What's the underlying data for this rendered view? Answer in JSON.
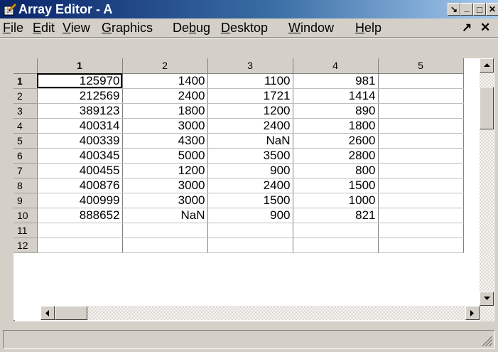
{
  "window": {
    "title": "Array Editor - A"
  },
  "title_buttons": {
    "dock": "↘",
    "minimize": "_",
    "maximize": "□",
    "close": "✕"
  },
  "menu": {
    "items": [
      {
        "accel": "F",
        "rest": "ile"
      },
      {
        "accel": "E",
        "rest": "dit"
      },
      {
        "accel": "V",
        "rest": "iew"
      },
      {
        "accel": "G",
        "rest": "raphics"
      },
      {
        "pre": "De",
        "accel": "b",
        "rest": "ug"
      },
      {
        "accel": "D",
        "rest": "esktop"
      },
      {
        "accel": "W",
        "rest": "indow"
      },
      {
        "accel": "H",
        "rest": "elp"
      }
    ],
    "undock_glyph": "↗",
    "close_glyph": "✕"
  },
  "grid": {
    "columns": [
      "1",
      "2",
      "3",
      "4",
      "5"
    ],
    "rows": [
      {
        "label": "1",
        "cells": [
          "125970",
          "1400",
          "1100",
          "981",
          ""
        ]
      },
      {
        "label": "2",
        "cells": [
          "212569",
          "2400",
          "1721",
          "1414",
          ""
        ]
      },
      {
        "label": "3",
        "cells": [
          "389123",
          "1800",
          "1200",
          "890",
          ""
        ]
      },
      {
        "label": "4",
        "cells": [
          "400314",
          "3000",
          "2400",
          "1800",
          ""
        ]
      },
      {
        "label": "5",
        "cells": [
          "400339",
          "4300",
          "NaN",
          "2600",
          ""
        ]
      },
      {
        "label": "6",
        "cells": [
          "400345",
          "5000",
          "3500",
          "2800",
          ""
        ]
      },
      {
        "label": "7",
        "cells": [
          "400455",
          "1200",
          "900",
          "800",
          ""
        ]
      },
      {
        "label": "8",
        "cells": [
          "400876",
          "3000",
          "2400",
          "1500",
          ""
        ]
      },
      {
        "label": "9",
        "cells": [
          "400999",
          "3000",
          "1500",
          "1000",
          ""
        ]
      },
      {
        "label": "10",
        "cells": [
          "888652",
          "NaN",
          "900",
          "821",
          ""
        ]
      },
      {
        "label": "11",
        "cells": [
          "",
          "",
          "",
          "",
          ""
        ]
      },
      {
        "label": "12",
        "cells": [
          "",
          "",
          "",
          "",
          ""
        ]
      }
    ]
  },
  "status": {
    "text": ""
  },
  "colors": {
    "titlebar_start": "#0a246a",
    "titlebar_end": "#a6caf0",
    "chrome": "#d4d0c8"
  }
}
